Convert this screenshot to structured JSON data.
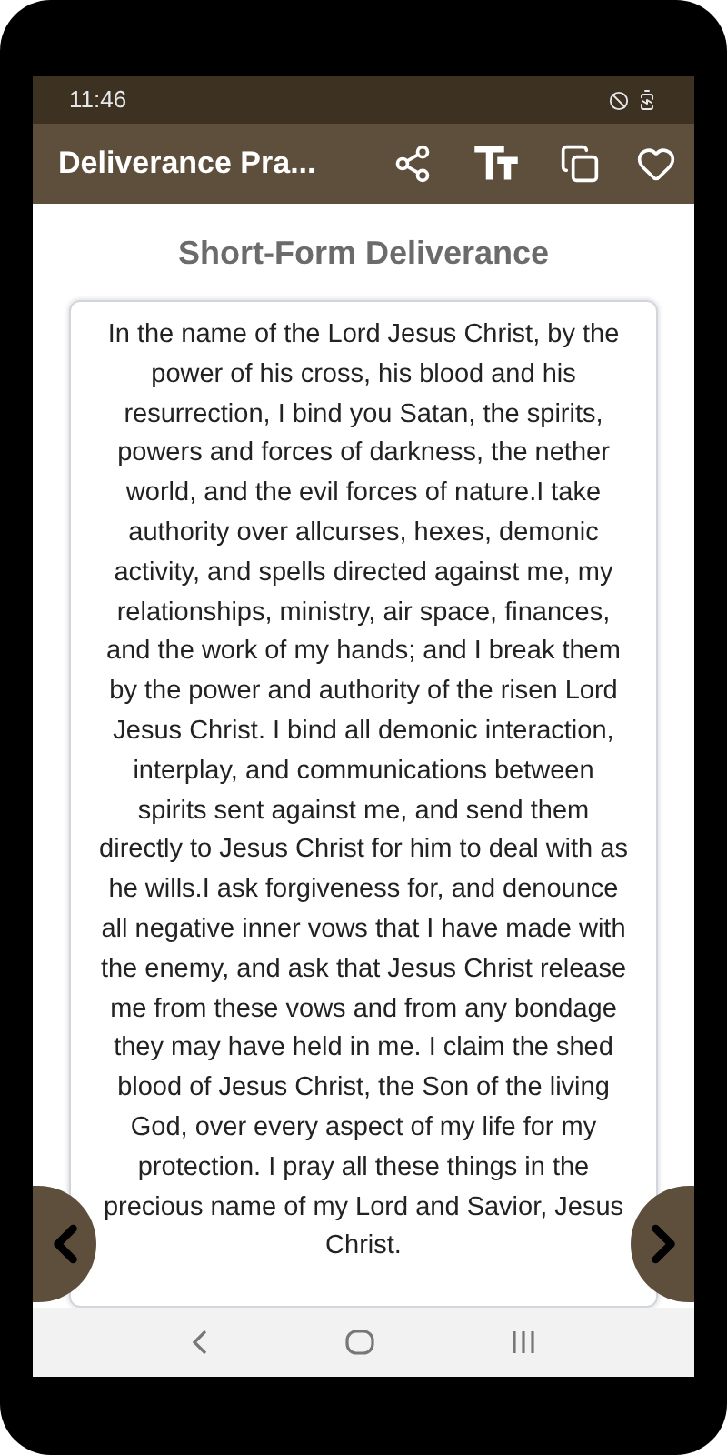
{
  "status_bar": {
    "time": "11:46"
  },
  "toolbar": {
    "title": "Deliverance Pra..."
  },
  "heading": "Short-Form Deliverance",
  "prayer": "In the name of the Lord Jesus Christ, by the power of his cross, his blood and his resurrection, I bind you Satan, the spirits, powers and forces of darkness, the nether world, and the evil forces of nature.I take authority over allcurses, hexes, demonic activity, and spells directed against me, my relationships, ministry, air space, finances, and the work of my hands; and I break them by the power and authority of the risen Lord Jesus Christ. I bind all demonic interaction, interplay, and communications between spirits sent against me, and send them directly to Jesus Christ for him to deal with as he wills.I ask forgiveness for, and denounce all negative inner vows that I have made with the enemy, and ask that Jesus Christ release me from these vows and from any bondage they may have held in me. I claim the shed blood of Jesus Christ, the Son of the living God, over every aspect of my life for my protection. I pray all these things in the precious name of my Lord and Savior, Jesus Christ."
}
